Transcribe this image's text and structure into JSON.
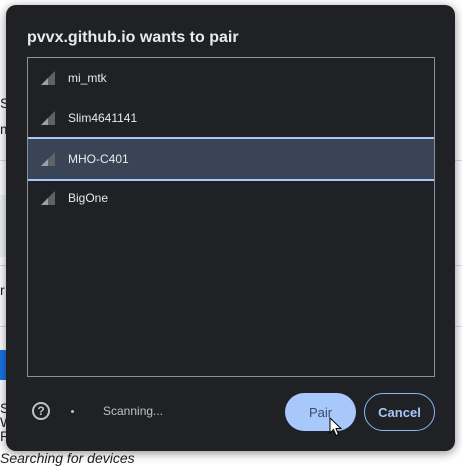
{
  "background": {
    "fragments": [
      "S",
      "m",
      "r",
      "S",
      "W",
      "R",
      "Searching for devices"
    ]
  },
  "dialog": {
    "title": "pvvx.github.io wants to pair",
    "devices": [
      {
        "name": "mi_mtk",
        "selected": false,
        "icon": "signal-strength-icon"
      },
      {
        "name": "Slim4641141",
        "selected": false,
        "icon": "signal-strength-icon"
      },
      {
        "name": "MHO-C401",
        "selected": true,
        "icon": "signal-strength-icon"
      },
      {
        "name": "BigOne",
        "selected": false,
        "icon": "signal-strength-icon"
      }
    ],
    "help_icon": "help-icon",
    "help_glyph": "?",
    "status": "Scanning...",
    "pair_label": "Pair",
    "cancel_label": "Cancel"
  },
  "colors": {
    "dialog_bg": "#202124",
    "selected_bg": "#394457",
    "accent": "#a8c7fa",
    "text": "#e8eaed"
  }
}
